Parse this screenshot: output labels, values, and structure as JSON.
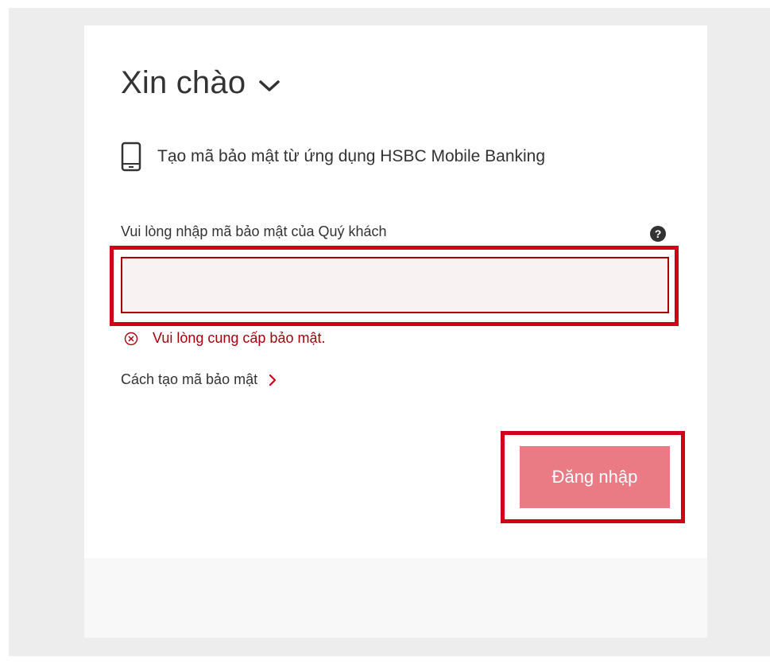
{
  "greeting": {
    "text": "Xin chào"
  },
  "device": {
    "text": "Tạo mã bảo mật từ ứng dụng HSBC Mobile Banking",
    "icon": "mobile-phone-icon"
  },
  "security_code": {
    "label": "Vui lòng nhập mã bảo mật của Quý khách",
    "value": "",
    "help_icon": "question-circle-icon",
    "help_glyph": "?"
  },
  "error": {
    "text": "Vui lòng cung cấp bảo mật.",
    "icon": "error-circle-x-icon"
  },
  "howto_link": {
    "text": "Cách tạo mã bảo mật",
    "icon": "chevron-right-icon"
  },
  "login_button": {
    "label": "Đăng nhập"
  },
  "colors": {
    "error_red": "#a8000b",
    "highlight_red": "#d00018",
    "button_pink": "#ea7a84",
    "input_bg": "#f9f2f3"
  }
}
